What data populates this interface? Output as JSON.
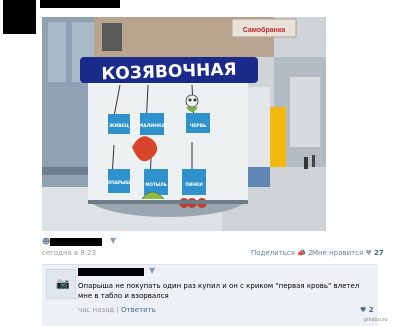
{
  "post": {
    "date": "сегодня в 8:23",
    "share_label": "Поделиться",
    "share_count": "2",
    "like_label": "Мне нравится",
    "like_count": "27"
  },
  "photo": {
    "kiosk_sign": "КОЗЯВОЧНАЯ",
    "shop_sign": "Самобранка",
    "signs": [
      "ЖИВЕЦ",
      "МАЛИНКА",
      "ЧЕРВЬ",
      "ОПАРЫШ",
      "МОТЫЛЬ",
      "ПИНКИ"
    ]
  },
  "comment": {
    "text": "Опарыша не покупать один раз купил и он с криком \"первая кровь\" влетел мне в табло и взорвался",
    "time": "час назад",
    "reply_label": "Ответить",
    "likes": "2"
  },
  "watermark": "pikabu.ru",
  "colors": {
    "link": "#45688e",
    "comment_bg": "#edf1f5",
    "kiosk_sign_bg": "#1a2a8a"
  }
}
